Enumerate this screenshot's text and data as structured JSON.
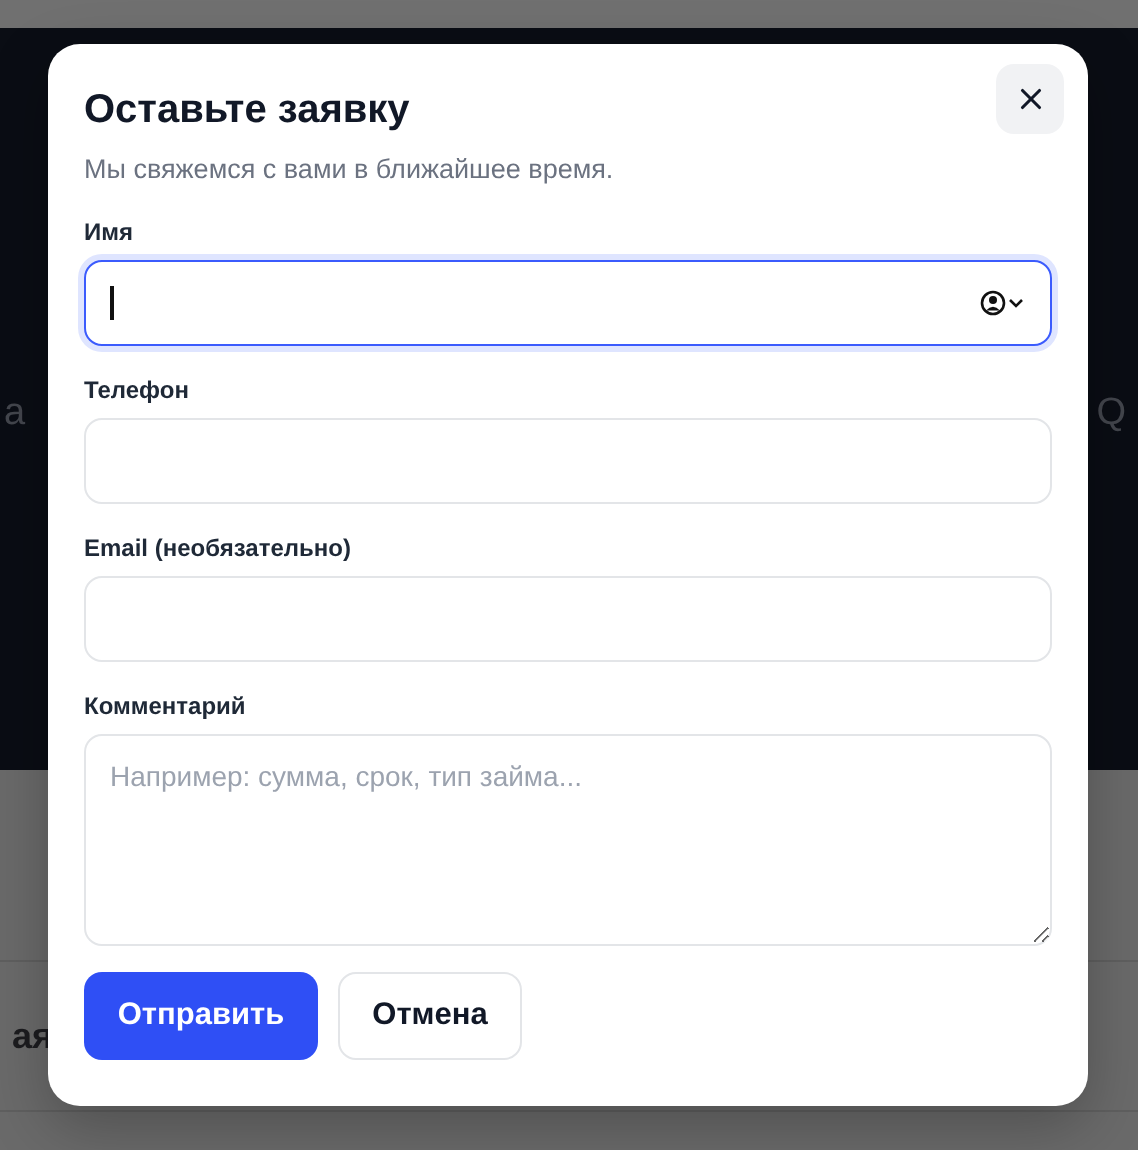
{
  "background": {
    "hero_left": "а",
    "hero_right": "Q",
    "section_left": "ая"
  },
  "dialog": {
    "title": "Оставьте заявку",
    "subtitle": "Мы свяжемся с вами в ближайшее время.",
    "fields": [
      {
        "label": "Имя",
        "kind": "input",
        "focused": true,
        "autofill": true
      },
      {
        "label": "Телефон",
        "kind": "input",
        "focused": false,
        "autofill": false
      },
      {
        "label": "Email (необязательно)",
        "kind": "input",
        "focused": false,
        "autofill": false
      },
      {
        "label": "Комментарий",
        "kind": "textarea",
        "focused": false,
        "placeholder": "Например: сумма, срок, тип займа..."
      }
    ],
    "buttons": [
      {
        "label": "Отправить",
        "kind": "primary"
      },
      {
        "label": "Отмена",
        "kind": "secondary"
      }
    ]
  }
}
